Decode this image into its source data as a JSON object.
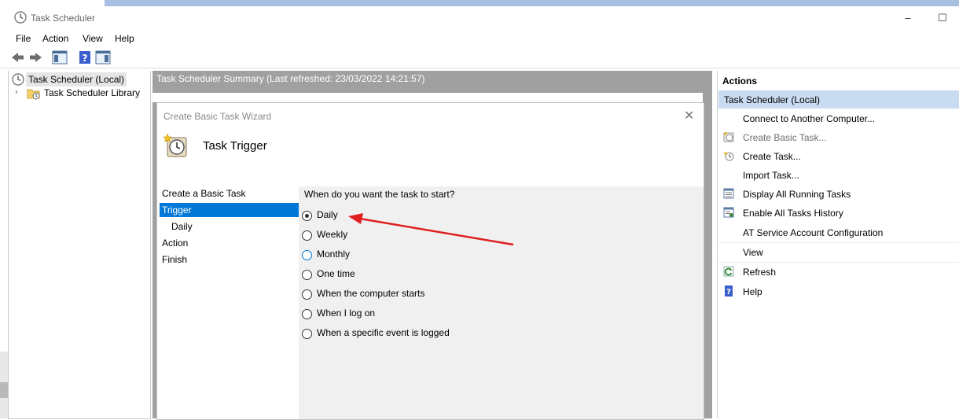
{
  "window": {
    "title": "Task Scheduler",
    "minimize": "–",
    "maximize": "☐"
  },
  "menu": [
    "File",
    "Action",
    "View",
    "Help"
  ],
  "tree": {
    "root": "Task Scheduler (Local)",
    "library": "Task Scheduler Library"
  },
  "summary": {
    "header": "Task Scheduler Summary (Last refreshed: 23/03/2022 14:21:57)"
  },
  "wizard": {
    "window_title": "Create Basic Task Wizard",
    "page_title": "Task Trigger",
    "steps": [
      "Create a Basic Task",
      "Trigger",
      "Daily",
      "Action",
      "Finish"
    ],
    "selected_step": "Trigger",
    "question": "When do you want the task to start?",
    "options": [
      "Daily",
      "Weekly",
      "Monthly",
      "One time",
      "When the computer starts",
      "When I log on",
      "When a specific event is logged"
    ],
    "selected_option": "Daily",
    "close": "✕"
  },
  "actions": {
    "header": "Actions",
    "section": "Task Scheduler (Local)",
    "items": [
      {
        "label": "Connect to Another Computer...",
        "icon": "none"
      },
      {
        "label": "Create Basic Task...",
        "icon": "clock-star-icon",
        "disabled": true
      },
      {
        "label": "Create Task...",
        "icon": "create-task-icon"
      },
      {
        "label": "Import Task...",
        "icon": "none"
      },
      {
        "label": "Display All Running Tasks",
        "icon": "list-icon"
      },
      {
        "label": "Enable All Tasks History",
        "icon": "history-icon"
      },
      {
        "label": "AT Service Account Configuration",
        "icon": "none"
      },
      {
        "label": "View",
        "icon": "none"
      },
      {
        "label": "Refresh",
        "icon": "refresh-icon"
      },
      {
        "label": "Help",
        "icon": "help-icon"
      }
    ]
  },
  "colors": {
    "accent": "#0078d7",
    "arrow": "#e02020",
    "header_gray": "#a0a0a0",
    "section_blue": "#c9dbf1"
  }
}
